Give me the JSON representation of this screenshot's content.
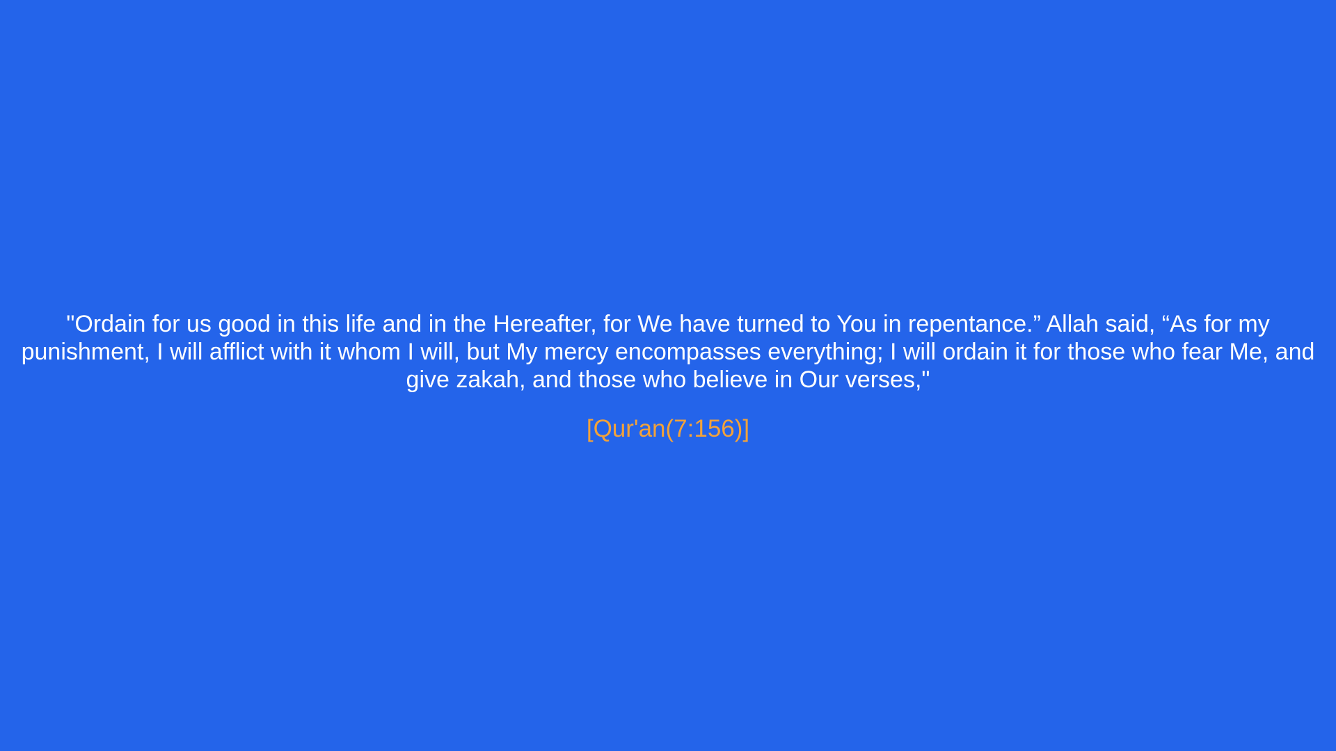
{
  "quote": {
    "text": "\"Ordain for us good in this life and in the Hereafter, for We have turned to You in repentance.” Allah said, “As for my punishment, I will afflict with it whom I will, but My mercy encompasses everything; I will ordain it for those who fear Me, and give zakah, and those who believe in Our verses,\"",
    "citation": "[Qur'an(7:156)]"
  },
  "colors": {
    "background": "#2464EA",
    "quote_text": "#FFFFFF",
    "citation": "#F2A23A"
  }
}
